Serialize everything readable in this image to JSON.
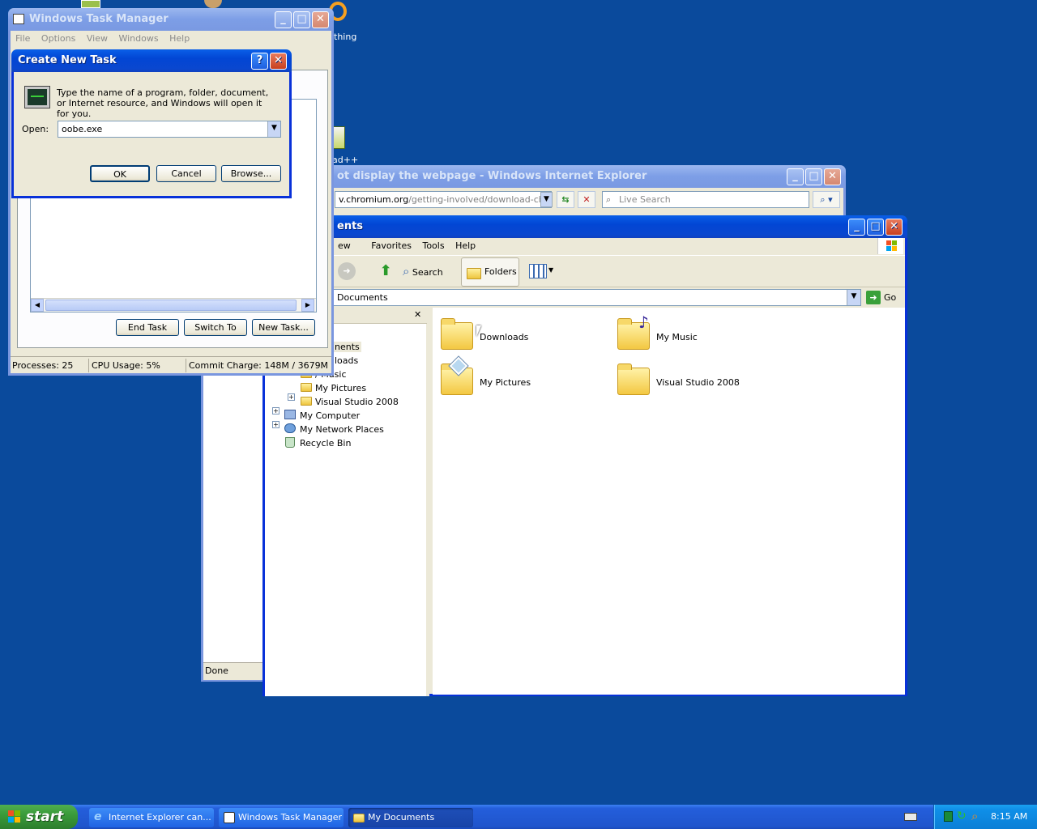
{
  "desktop": {
    "icon_label_partial_1": "thing",
    "icon_label_partial_2": "ad++"
  },
  "ie_window": {
    "title": "ot display the webpage - Windows Internet Explorer",
    "address_domain": "v.chromium.org",
    "address_path": "/getting-involved/download-chromiu",
    "search_placeholder": "Live Search",
    "status": "Done"
  },
  "explorer_window": {
    "title": "ents",
    "menu": [
      "ew",
      "Favorites",
      "Tools",
      "Help"
    ],
    "toolbar": {
      "search_label": "Search",
      "folders_label": "Folders"
    },
    "address_value": "Documents",
    "go_label": "Go",
    "close_pane_glyph": "✕",
    "tree": [
      {
        "label": "nents",
        "indent": 0
      },
      {
        "label": "loads",
        "indent": 0
      },
      {
        "label": "/ Music",
        "indent": 0
      },
      {
        "label": "My Pictures",
        "indent": 0
      },
      {
        "label": "Visual Studio 2008",
        "indent": 0
      },
      {
        "label": "My Computer",
        "indent": 0
      },
      {
        "label": "My Network Places",
        "indent": 0
      },
      {
        "label": "Recycle Bin",
        "indent": 0
      }
    ],
    "items": [
      {
        "label": "Downloads"
      },
      {
        "label": "My Music"
      },
      {
        "label": "My Pictures"
      },
      {
        "label": "Visual Studio 2008"
      }
    ]
  },
  "task_manager": {
    "title": "Windows Task Manager",
    "menu": [
      "File",
      "Options",
      "View",
      "Windows",
      "Help"
    ],
    "buttons": {
      "end_task": "End Task",
      "switch_to": "Switch To",
      "new_task": "New Task..."
    },
    "status": {
      "processes": "Processes: 25",
      "cpu": "CPU Usage: 5%",
      "commit": "Commit Charge: 148M / 3679M"
    }
  },
  "create_new_task": {
    "title": "Create New Task",
    "help_glyph": "?",
    "description": "Type the name of a program, folder, document, or Internet resource, and Windows will open it for you.",
    "open_label": "Open:",
    "open_value": "oobe.exe",
    "ok": "OK",
    "cancel": "Cancel",
    "browse": "Browse..."
  },
  "taskbar": {
    "start_label": "start",
    "buttons": [
      {
        "label": "Internet Explorer can..."
      },
      {
        "label": "Windows Task Manager"
      },
      {
        "label": "My Documents"
      }
    ],
    "clock": "8:15 AM"
  },
  "colors": {
    "desktop": "#0a4a9c",
    "title_active": "#0246d4",
    "taskbar": "#245edb",
    "start": "#3a9b3a",
    "tray": "#0f8fe8"
  }
}
